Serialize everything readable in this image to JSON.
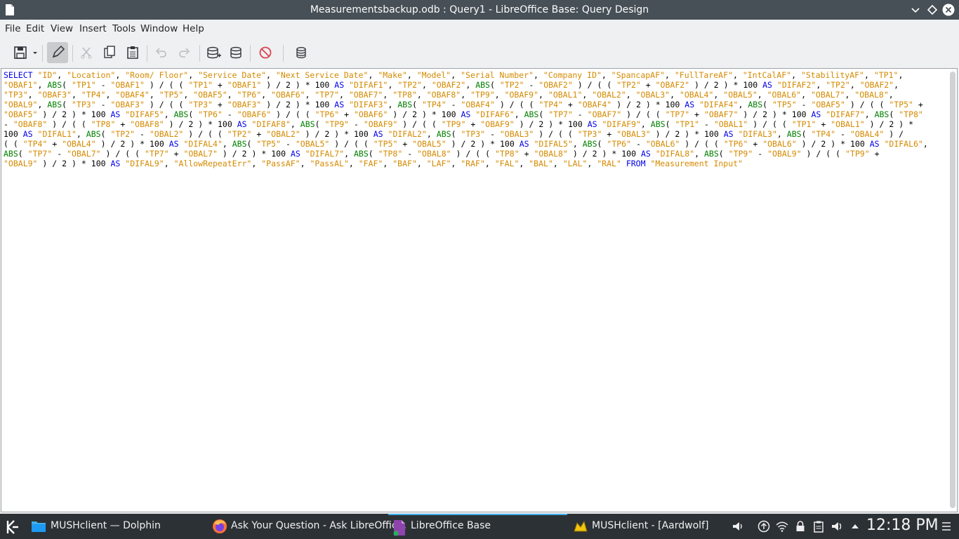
{
  "window": {
    "title": "Measurementsbackup.odb : Query1 - LibreOffice Base: Query Design"
  },
  "menu": [
    "File",
    "Edit",
    "View",
    "Insert",
    "Tools",
    "Window",
    "Help"
  ],
  "toolbar": {
    "buttons": [
      "save-icon",
      "save-dropdown-icon",
      "edit-mode-icon",
      "cut-icon",
      "copy-icon",
      "paste-icon",
      "undo-icon",
      "redo-icon",
      "add-table-icon",
      "run-query-icon",
      "clear-query-icon",
      "switch-design-view-icon"
    ]
  },
  "editor": {
    "lines": [
      "SELECT \"ID\", \"Location\", \"Room/ Floor\", \"Service Date\", \"Next Service Date\", \"Make\", \"Model\", \"Serial Number\", \"Company ID\", \"SpancapAF\", \"FullTareAF\", \"IntCalAF\", \"StabilityAF\", \"TP1\",",
      "\"OBAF1\", ABS( \"TP1\" - \"OBAF1\" ) / ( ( \"TP1\" + \"OBAF1\" ) / 2 ) * 100 AS \"DIFAF1\", \"TP2\", \"OBAF2\", ABS( \"TP2\" - \"OBAF2\" ) / ( ( \"TP2\" + \"OBAF2\" ) / 2 ) * 100 AS \"DIFAF2\", \"TP2\", \"OBAF2\",",
      "\"TP3\", \"OBAF3\", \"TP4\", \"OBAF4\", \"TP5\", \"OBAF5\", \"TP6\", \"OBAF6\", \"TP7\", \"OBAF7\", \"TP8\", \"OBAF8\", \"TP9\", \"OBAF9\", \"OBAL1\", \"OBAL2\", \"OBAL3\", \"OBAL4\", \"OBAL5\", \"OBAL6\", \"OBAL7\", \"OBAL8\",",
      "\"OBAL9\", ABS( \"TP3\" - \"OBAF3\" ) / ( ( \"TP3\" + \"OBAF3\" ) / 2 ) * 100 AS \"DIFAF3\", ABS( \"TP4\" - \"OBAF4\" ) / ( ( \"TP4\" + \"OBAF4\" ) / 2 ) * 100 AS \"DIFAF4\", ABS( \"TP5\" - \"OBAF5\" ) / ( ( \"TP5\" +",
      "\"OBAF5\" ) / 2 ) * 100 AS \"DIFAF5\", ABS( \"TP6\" - \"OBAF6\" ) / ( ( \"TP6\" + \"OBAF6\" ) / 2 ) * 100 AS \"DIFAF6\", ABS( \"TP7\" - \"OBAF7\" ) / ( ( \"TP7\" + \"OBAF7\" ) / 2 ) * 100 AS \"DIFAF7\", ABS( \"TP8\"",
      "- \"OBAF8\" ) / ( ( \"TP8\" + \"OBAF8\" ) / 2 ) * 100 AS \"DIFAF8\", ABS( \"TP9\" - \"OBAF9\" ) / ( ( \"TP9\" + \"OBAF9\" ) / 2 ) * 100 AS \"DIFAF9\", ABS( \"TP1\" - \"OBAL1\" ) / ( ( \"TP1\" + \"OBAL1\" ) / 2 ) *",
      "100 AS \"DIFAL1\", ABS( \"TP2\" - \"OBAL2\" ) / ( ( \"TP2\" + \"OBAL2\" ) / 2 ) * 100 AS \"DIFAL2\", ABS( \"TP3\" - \"OBAL3\" ) / ( ( \"TP3\" + \"OBAL3\" ) / 2 ) * 100 AS \"DIFAL3\", ABS( \"TP4\" - \"OBAL4\" ) /",
      "( ( \"TP4\" + \"OBAL4\" ) / 2 ) * 100 AS \"DIFAL4\", ABS( \"TP5\" - \"OBAL5\" ) / ( ( \"TP5\" + \"OBAL5\" ) / 2 ) * 100 AS \"DIFAL5\", ABS( \"TP6\" - \"OBAL6\" ) / ( ( \"TP6\" + \"OBAL6\" ) / 2 ) * 100 AS \"DIFAL6\",",
      "ABS( \"TP7\" - \"OBAL7\" ) / ( ( \"TP7\" + \"OBAL7\" ) / 2 ) * 100 AS \"DIFAL7\", ABS( \"TP8\" - \"OBAL8\" ) / ( ( \"TP8\" + \"OBAL8\" ) / 2 ) * 100 AS \"DIFAL8\", ABS( \"TP9\" - \"OBAL9\" ) / ( ( \"TP9\" +",
      "\"OBAL9\" ) / 2 ) * 100 AS \"DIFAL9\", \"AllowRepeatErr\", \"PassAF\", \"PassAL\", \"FAF\", \"BAF\", \"LAF\", \"RAF\", \"FAL\", \"BAL\", \"LAL\", \"RAL\" FROM \"Measurement Input\""
    ],
    "colors": {
      "keyword": "#0000e6",
      "identifier": "#d58a00",
      "function": "#008000"
    }
  },
  "taskbar": {
    "tasks": [
      {
        "label": "MUSHclient — Dolphin",
        "icon": "folder-icon"
      },
      {
        "label": "Ask Your Question - Ask LibreOffic...",
        "icon": "firefox-icon"
      },
      {
        "label": "LibreOffice Base",
        "icon": "libreoffice-base-icon"
      },
      {
        "label": "MUSHclient - [Aardwolf]",
        "icon": "mushclient-icon"
      }
    ],
    "clock": "12:18 PM"
  }
}
